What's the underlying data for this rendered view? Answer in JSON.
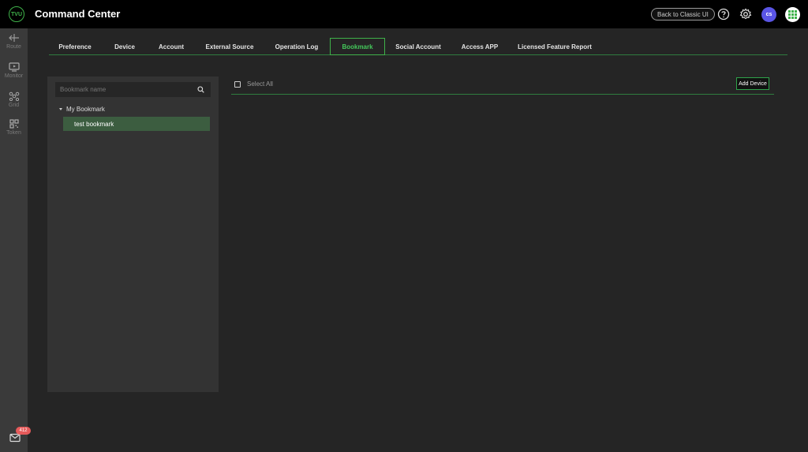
{
  "header": {
    "logo_text": "TVU",
    "title": "Command Center",
    "classic_button_label": "Back to Classic UI",
    "avatar_initials": "cs",
    "icons": [
      "help-icon",
      "settings-icon",
      "apps-grid-icon"
    ]
  },
  "sidebar": {
    "items": [
      {
        "label": "Route",
        "icon": "route-icon"
      },
      {
        "label": "Monitor",
        "icon": "monitor-icon"
      },
      {
        "label": "Grid",
        "icon": "grid-network-icon"
      },
      {
        "label": "Token",
        "icon": "qr-code-icon"
      }
    ],
    "mail_badge": "412"
  },
  "tabs": [
    {
      "label": "Preference",
      "active": false
    },
    {
      "label": "Device",
      "active": false
    },
    {
      "label": "Account",
      "active": false
    },
    {
      "label": "External Source",
      "active": false
    },
    {
      "label": "Operation Log",
      "active": false
    },
    {
      "label": "Bookmark",
      "active": true
    },
    {
      "label": "Social Account",
      "active": false
    },
    {
      "label": "Access APP",
      "active": false
    },
    {
      "label": "Licensed Feature Report",
      "active": false
    }
  ],
  "bookmark_panel": {
    "search_placeholder": "Bookmark name",
    "root_label": "My Bookmark",
    "child_label": "test bookmark"
  },
  "main": {
    "select_all_label": "Select All",
    "add_device_label": "Add Device"
  },
  "colors": {
    "accent": "#3fb24a",
    "avatar": "#5a55e5",
    "badge": "#e65b5b",
    "selected_row": "#3c5d40"
  }
}
